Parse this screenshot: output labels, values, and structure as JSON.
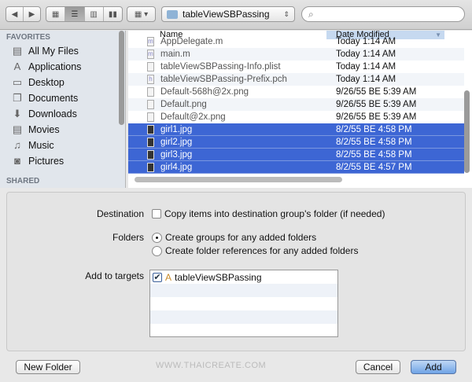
{
  "toolbar": {
    "path": "tableViewSBPassing",
    "search_placeholder": ""
  },
  "sidebar": {
    "favorites_heading": "FAVORITES",
    "shared_heading": "SHARED",
    "items": [
      {
        "label": "All My Files",
        "icon": "all-files-icon"
      },
      {
        "label": "Applications",
        "icon": "applications-icon"
      },
      {
        "label": "Desktop",
        "icon": "desktop-icon"
      },
      {
        "label": "Documents",
        "icon": "documents-icon"
      },
      {
        "label": "Downloads",
        "icon": "downloads-icon"
      },
      {
        "label": "Movies",
        "icon": "movies-icon"
      },
      {
        "label": "Music",
        "icon": "music-icon"
      },
      {
        "label": "Pictures",
        "icon": "pictures-icon"
      }
    ]
  },
  "files": {
    "col_name": "Name",
    "col_date": "Date Modified",
    "rows": [
      {
        "name": "AppDelegate.m",
        "date": "Today 1:14 AM",
        "badge": "m"
      },
      {
        "name": "main.m",
        "date": "Today 1:14 AM",
        "badge": "m"
      },
      {
        "name": "tableViewSBPassing-Info.plist",
        "date": "Today 1:14 AM",
        "badge": ""
      },
      {
        "name": "tableViewSBPassing-Prefix.pch",
        "date": "Today 1:14 AM",
        "badge": "h"
      },
      {
        "name": "Default-568h@2x.png",
        "date": "9/26/55 BE 5:39 AM",
        "badge": ""
      },
      {
        "name": "Default.png",
        "date": "9/26/55 BE 5:39 AM",
        "badge": ""
      },
      {
        "name": "Default@2x.png",
        "date": "9/26/55 BE 5:39 AM",
        "badge": ""
      },
      {
        "name": "girl1.jpg",
        "date": "8/2/55 BE 4:58 PM",
        "badge": ""
      },
      {
        "name": "girl2.jpg",
        "date": "8/2/55 BE 4:58 PM",
        "badge": ""
      },
      {
        "name": "girl3.jpg",
        "date": "8/2/55 BE 4:58 PM",
        "badge": ""
      },
      {
        "name": "girl4.jpg",
        "date": "8/2/55 BE 4:57 PM",
        "badge": ""
      }
    ]
  },
  "options": {
    "destination_label": "Destination",
    "copy_label": "Copy items into destination group's folder (if needed)",
    "copy_checked": false,
    "folders_label": "Folders",
    "groups_label": "Create groups for any added folders",
    "refs_label": "Create folder references for any added folders",
    "targets_label": "Add to targets",
    "target_name": "tableViewSBPassing",
    "target_checked": true
  },
  "buttons": {
    "new_folder": "New Folder",
    "cancel": "Cancel",
    "add": "Add"
  },
  "watermark": "WWW.THAICREATE.COM"
}
